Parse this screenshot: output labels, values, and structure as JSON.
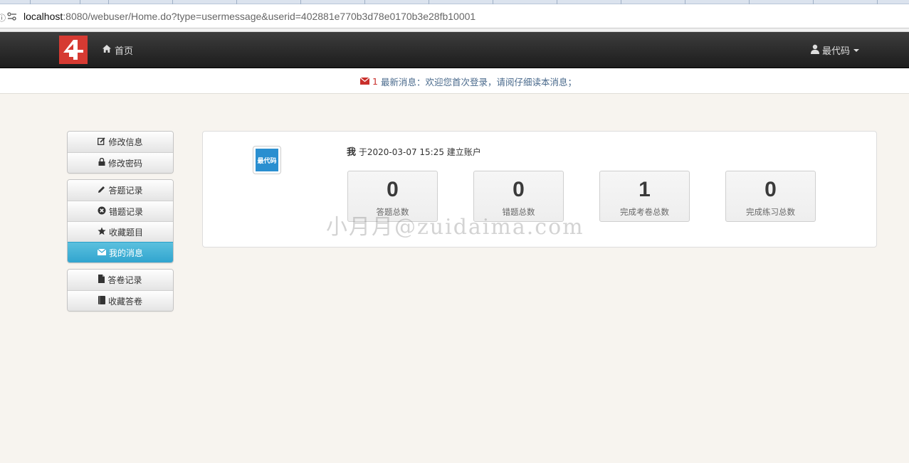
{
  "browser": {
    "url_host": "localhost",
    "url_rest": ":8080/webuser/Home.do?type=usermessage&userid=402881e770b3d78e0170b3e28fb10001"
  },
  "navbar": {
    "logo_icon": "site-logo",
    "home_label": "首页",
    "user_label": "最代码"
  },
  "message_bar": {
    "count": "1",
    "text": "最新消息：欢迎您首次登录，请阅仔细读本消息；"
  },
  "sidebar": {
    "groups": [
      [
        {
          "label": "修改信息",
          "icon": "edit-icon"
        },
        {
          "label": "修改密码",
          "icon": "lock-icon"
        }
      ],
      [
        {
          "label": "答题记录",
          "icon": "pencil-icon"
        },
        {
          "label": "错题记录",
          "icon": "error-circle-icon"
        },
        {
          "label": "收藏题目",
          "icon": "star-icon"
        },
        {
          "label": "我的消息",
          "icon": "envelope-icon",
          "active": true
        }
      ],
      [
        {
          "label": "答卷记录",
          "icon": "file-icon"
        },
        {
          "label": "收藏答卷",
          "icon": "book-icon"
        }
      ]
    ]
  },
  "profile": {
    "avatar_text": "最代码",
    "me": "我",
    "created_text": "于2020-03-07 15:25 建立账户"
  },
  "stats": [
    {
      "value": "0",
      "label": "答题总数"
    },
    {
      "value": "0",
      "label": "错题总数"
    },
    {
      "value": "1",
      "label": "完成考卷总数"
    },
    {
      "value": "0",
      "label": "完成练习总数"
    }
  ],
  "watermark": "小月月@zuidaima.com",
  "colors": {
    "accent": "#31a5cf",
    "navbar": "#2a2a2a",
    "logo": "#d63a32",
    "message_count": "#c9302c"
  }
}
